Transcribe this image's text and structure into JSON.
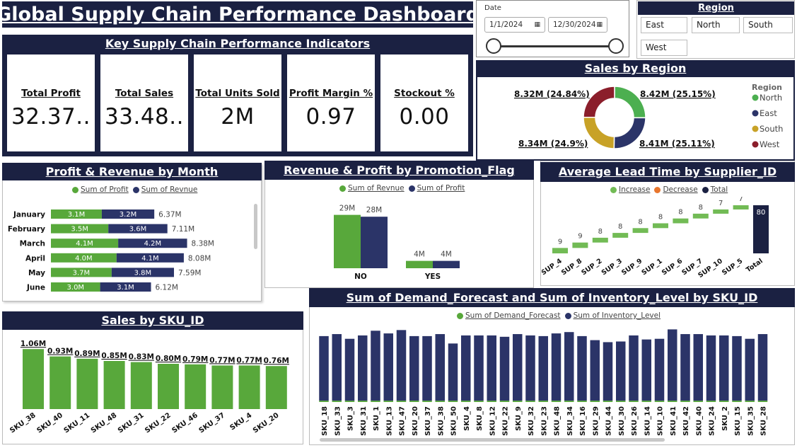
{
  "title": "Global Supply Chain Performance Dashboard",
  "colors": {
    "navy": "#1b2142",
    "green": "#58a83b",
    "seriesBlue": "#2b3468",
    "north": "#4caf50",
    "east": "#2b3468",
    "south": "#c8a227",
    "west": "#8b1e2b"
  },
  "kpi": {
    "header": "Key Supply Chain Performance Indicators",
    "cards": [
      {
        "label": "Total Profit",
        "value": "32.37.."
      },
      {
        "label": "Total Sales",
        "value": "33.48.."
      },
      {
        "label": "Total Units Sold",
        "value": "2M"
      },
      {
        "label": "Profit Margin %",
        "value": "0.97"
      },
      {
        "label": "Stockout %",
        "value": "0.00"
      }
    ]
  },
  "date_slicer": {
    "label": "Date",
    "start": "1/1/2024",
    "end": "12/30/2024",
    "calendar_icon": "calendar-icon"
  },
  "region_slicer": {
    "header": "Region",
    "options": [
      "East",
      "North",
      "South",
      "West"
    ]
  },
  "sales_by_region": {
    "header": "Sales by Region",
    "legend_title": "Region",
    "labels": {
      "north": "8.42M (25.15%)",
      "east": "8.41M (25.11%)",
      "south": "8.34M (24.9%)",
      "west": "8.32M (24.84%)"
    }
  },
  "profit_revenue": {
    "header": "Profit & Revenue by Month",
    "legend": [
      "Sum of Profit",
      "Sum of Revnue"
    ]
  },
  "promotion": {
    "header": "Revenue & Profit by Promotion_Flag",
    "legend": [
      "Sum of Revnue",
      "Sum of Profit"
    ]
  },
  "lead_time": {
    "header": "Average Lead Time by Supplier_ID",
    "legend": [
      "Increase",
      "Decrease",
      "Total"
    ]
  },
  "sku_sales": {
    "header": "Sales by SKU_ID"
  },
  "demand_inventory": {
    "header": "Sum of Demand_Forecast and Sum of Inventory_Level by SKU_ID",
    "legend": [
      "Sum of Demand_Forecast",
      "Sum of Inventory_Level"
    ]
  },
  "chart_data": [
    {
      "id": "sales_by_region",
      "type": "pie",
      "donut": true,
      "categories": [
        "North",
        "East",
        "South",
        "West"
      ],
      "values": [
        8.42,
        8.41,
        8.34,
        8.32
      ],
      "value_unit": "M",
      "percentages": [
        25.15,
        25.11,
        24.9,
        24.84
      ],
      "legend": "right"
    },
    {
      "id": "profit_revenue_by_month",
      "type": "bar",
      "orientation": "horizontal",
      "stacked": true,
      "categories": [
        "January",
        "February",
        "March",
        "April",
        "May",
        "June"
      ],
      "series": [
        {
          "name": "Sum of Profit",
          "values": [
            3.1,
            3.5,
            4.1,
            4.0,
            3.7,
            3.0
          ],
          "labels": [
            "3.1M",
            "3.5M",
            "4.1M",
            "4.0M",
            "3.7M",
            "3.0M"
          ]
        },
        {
          "name": "Sum of Revnue",
          "values": [
            3.2,
            3.6,
            4.2,
            4.1,
            3.8,
            3.1
          ],
          "labels": [
            "3.2M",
            "3.6M",
            "4.2M",
            "4.1M",
            "3.8M",
            "3.1M"
          ]
        }
      ],
      "totals": [
        "6.37M",
        "7.11M",
        "8.38M",
        "8.08M",
        "7.59M",
        "6.12M"
      ],
      "xlim": [
        0,
        9
      ],
      "legend": "top"
    },
    {
      "id": "revenue_profit_by_promotion",
      "type": "bar",
      "categories": [
        "NO",
        "YES"
      ],
      "series": [
        {
          "name": "Sum of Revnue",
          "values": [
            29,
            4
          ],
          "labels": [
            "29M",
            "4M"
          ]
        },
        {
          "name": "Sum of Profit",
          "values": [
            28,
            4
          ],
          "labels": [
            "28M",
            "4M"
          ]
        }
      ],
      "ylim": [
        0,
        30
      ],
      "legend": "top"
    },
    {
      "id": "lead_time_waterfall",
      "type": "bar",
      "subtype": "waterfall",
      "categories": [
        "SUP_4",
        "SUP_8",
        "SUP_2",
        "SUP_3",
        "SUP_9",
        "SUP_1",
        "SUP_6",
        "SUP_7",
        "SUP_10",
        "SUP_5",
        "Total"
      ],
      "values": [
        9,
        9,
        8,
        8,
        8,
        8,
        8,
        8,
        7,
        7,
        80
      ],
      "ylim": [
        0,
        80
      ],
      "legend": "top"
    },
    {
      "id": "sales_by_sku",
      "type": "bar",
      "categories": [
        "SKU_38",
        "SKU_40",
        "SKU_11",
        "SKU_48",
        "SKU_31",
        "SKU_22",
        "SKU_46",
        "SKU_37",
        "SKU_4",
        "SKU_20"
      ],
      "values": [
        1.06,
        0.93,
        0.89,
        0.85,
        0.83,
        0.8,
        0.79,
        0.77,
        0.77,
        0.76
      ],
      "labels": [
        "1.06M",
        "0.93M",
        "0.89M",
        "0.85M",
        "0.83M",
        "0.80M",
        "0.79M",
        "0.77M",
        "0.77M",
        "0.76M"
      ],
      "ylim": [
        0,
        1.1
      ]
    },
    {
      "id": "demand_inventory_by_sku",
      "type": "bar",
      "stacked": true,
      "categories": [
        "SKU_18",
        "SKU_33",
        "SKU_3",
        "SKU_31",
        "SKU_1",
        "SKU_13",
        "SKU_47",
        "SKU_20",
        "SKU_37",
        "SKU_38",
        "SKU_50",
        "SKU_4",
        "SKU_8",
        "SKU_12",
        "SKU_22",
        "SKU_9",
        "SKU_32",
        "SKU_23",
        "SKU_48",
        "SKU_34",
        "SKU_16",
        "SKU_29",
        "SKU_44",
        "SKU_30",
        "SKU_26",
        "SKU_14",
        "SKU_10",
        "SKU_41",
        "SKU_42",
        "SKU_40",
        "SKU_24",
        "SKU_2",
        "SKU_15",
        "SKU_35",
        "SKU_28"
      ],
      "series": [
        {
          "name": "Sum of Demand_Forecast",
          "values": [
            2,
            2,
            2,
            2,
            2,
            2,
            2,
            2,
            2,
            2,
            2,
            2,
            2,
            2,
            2,
            2,
            2,
            2,
            2,
            2,
            2,
            2,
            2,
            2,
            2,
            2,
            2,
            2,
            2,
            2,
            2,
            2,
            2,
            2,
            2
          ]
        },
        {
          "name": "Sum of Inventory_Level",
          "values": [
            96,
            99,
            92,
            97,
            104,
            100,
            105,
            96,
            96,
            99,
            85,
            97,
            97,
            97,
            95,
            99,
            97,
            96,
            100,
            102,
            96,
            90,
            87,
            88,
            97,
            91,
            92,
            106,
            99,
            99,
            97,
            97,
            96,
            92,
            99
          ]
        }
      ],
      "legend": "top"
    }
  ]
}
